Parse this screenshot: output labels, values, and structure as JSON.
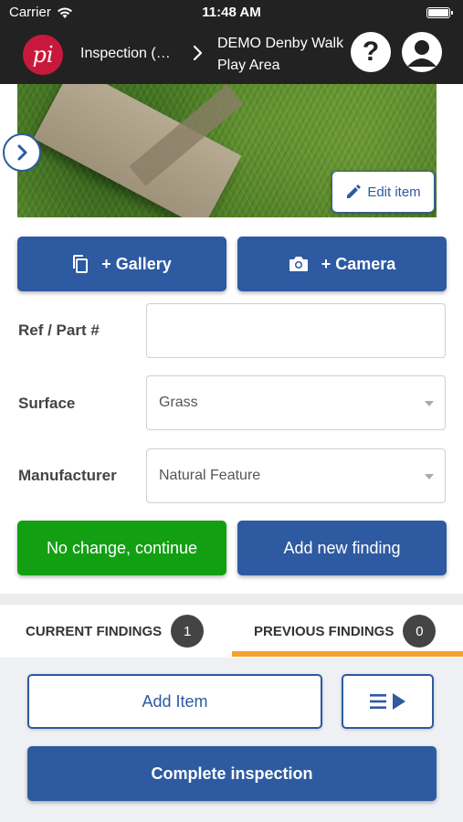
{
  "status_bar": {
    "carrier": "Carrier",
    "time": "11:48 AM"
  },
  "header": {
    "logo_text": "pi",
    "breadcrumb_parent": "Inspection (…",
    "breadcrumb_current": "DEMO Denby Walk Play Area",
    "help_label": "?"
  },
  "photo": {
    "edit_label": "Edit item"
  },
  "media": {
    "gallery_label": "+ Gallery",
    "camera_label": "+ Camera"
  },
  "form": {
    "ref_label": "Ref / Part #",
    "ref_value": "",
    "surface_label": "Surface",
    "surface_value": "Grass",
    "manufacturer_label": "Manufacturer",
    "manufacturer_value": "Natural Feature"
  },
  "actions": {
    "no_change_label": "No change, continue",
    "add_finding_label": "Add new finding"
  },
  "tabs": [
    {
      "label": "CURRENT FINDINGS",
      "count": "1"
    },
    {
      "label": "PREVIOUS FINDINGS",
      "count": "0",
      "active": true
    }
  ],
  "bottom": {
    "add_item_label": "Add Item",
    "complete_label": "Complete inspection"
  },
  "colors": {
    "primary": "#2d5aa0",
    "success": "#12a012",
    "brand": "#c8193c",
    "tab_indicator": "#f2a230",
    "header_bg": "#222222"
  },
  "icons": [
    "wifi-icon",
    "battery-icon",
    "chevron-right-icon",
    "help-icon",
    "profile-icon",
    "pencil-icon",
    "gallery-icon",
    "camera-icon",
    "dropdown-caret-icon",
    "menu-play-icon"
  ]
}
